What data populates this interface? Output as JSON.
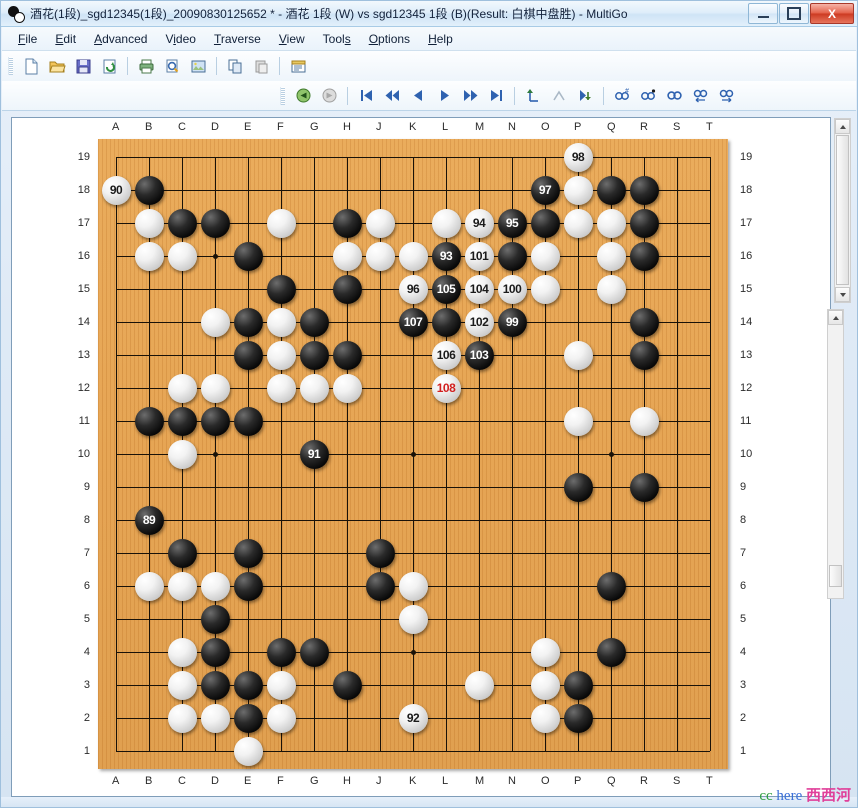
{
  "window": {
    "title": "酒花(1段)_sgd12345(1段)_20090830125652 * - 酒花 1段 (W) vs sgd12345 1段 (B)(Result: 白棋中盘胜) - MultiGo",
    "app_name": "MultiGo",
    "icon": "go-stones-icon",
    "minimize_label": "Minimize",
    "maximize_label": "Maximize",
    "close_label": "X"
  },
  "menu": {
    "items": [
      {
        "label": "File",
        "accel": "F"
      },
      {
        "label": "Edit",
        "accel": "E"
      },
      {
        "label": "Advanced",
        "accel": "A"
      },
      {
        "label": "Video",
        "accel": "i"
      },
      {
        "label": "Traverse",
        "accel": "T"
      },
      {
        "label": "View",
        "accel": "V"
      },
      {
        "label": "Tools",
        "accel": "s"
      },
      {
        "label": "Options",
        "accel": "O"
      },
      {
        "label": "Help",
        "accel": "H"
      }
    ]
  },
  "toolbar_file": {
    "buttons": [
      {
        "name": "new-icon",
        "label": "New"
      },
      {
        "name": "open-folder-icon",
        "label": "Open"
      },
      {
        "name": "save-disk-icon",
        "label": "Save"
      },
      {
        "name": "refresh-icon",
        "label": "Reload"
      },
      {
        "name": "print-icon",
        "label": "Print"
      },
      {
        "name": "print-preview-icon",
        "label": "Print Preview"
      },
      {
        "name": "export-image-icon",
        "label": "Export Image"
      },
      {
        "name": "copy-icon",
        "label": "Copy"
      },
      {
        "name": "paste-icon",
        "label": "Paste"
      },
      {
        "name": "properties-icon",
        "label": "Game Info"
      }
    ]
  },
  "toolbar_nav": {
    "buttons": [
      {
        "name": "black-to-move-icon",
        "label": "Black Move"
      },
      {
        "name": "white-to-move-icon",
        "label": "White Move"
      },
      {
        "name": "first-move-icon",
        "label": "First"
      },
      {
        "name": "rewind-icon",
        "label": "Back 10"
      },
      {
        "name": "prev-move-icon",
        "label": "Previous"
      },
      {
        "name": "next-move-icon",
        "label": "Next"
      },
      {
        "name": "forward-icon",
        "label": "Forward 10"
      },
      {
        "name": "last-move-icon",
        "label": "Last"
      },
      {
        "name": "branch-up-icon",
        "label": "Previous Branch"
      },
      {
        "name": "branch-merge-icon",
        "label": "Branch"
      },
      {
        "name": "branch-enter-icon",
        "label": "Enter Branch"
      },
      {
        "name": "find-number-icon",
        "label": "Find Move Number"
      },
      {
        "name": "find-mark-icon",
        "label": "Find Mark"
      },
      {
        "name": "find-icon",
        "label": "Find"
      },
      {
        "name": "find-prev-icon",
        "label": "Find Previous"
      },
      {
        "name": "find-next-icon",
        "label": "Find Next"
      }
    ]
  },
  "board": {
    "size": 19,
    "col_labels": [
      "A",
      "B",
      "C",
      "D",
      "E",
      "F",
      "G",
      "H",
      "J",
      "K",
      "L",
      "M",
      "N",
      "O",
      "P",
      "Q",
      "R",
      "S",
      "T"
    ],
    "row_labels": [
      "19",
      "18",
      "17",
      "16",
      "15",
      "14",
      "13",
      "12",
      "11",
      "10",
      "9",
      "8",
      "7",
      "6",
      "5",
      "4",
      "3",
      "2",
      "1"
    ],
    "wood_color": "#e3a04e",
    "line_color": "#1a1208",
    "hoshi": [
      [
        3,
        3
      ],
      [
        9,
        3
      ],
      [
        15,
        3
      ],
      [
        3,
        9
      ],
      [
        9,
        9
      ],
      [
        15,
        9
      ],
      [
        3,
        15
      ],
      [
        9,
        15
      ],
      [
        15,
        15
      ]
    ],
    "current_move_number": 108,
    "current_move_color": "#d22020",
    "stones": [
      {
        "c": "A",
        "r": 18,
        "col": "W",
        "n": "90"
      },
      {
        "c": "B",
        "r": 18,
        "col": "B"
      },
      {
        "c": "B",
        "r": 17,
        "col": "W"
      },
      {
        "c": "C",
        "r": 17,
        "col": "B"
      },
      {
        "c": "D",
        "r": 17,
        "col": "B"
      },
      {
        "c": "B",
        "r": 16,
        "col": "W"
      },
      {
        "c": "C",
        "r": 16,
        "col": "W"
      },
      {
        "c": "E",
        "r": 16,
        "col": "B"
      },
      {
        "c": "F",
        "r": 17,
        "col": "W"
      },
      {
        "c": "H",
        "r": 17,
        "col": "B"
      },
      {
        "c": "J",
        "r": 17,
        "col": "W"
      },
      {
        "c": "H",
        "r": 16,
        "col": "W"
      },
      {
        "c": "J",
        "r": 16,
        "col": "W"
      },
      {
        "c": "F",
        "r": 15,
        "col": "B"
      },
      {
        "c": "H",
        "r": 15,
        "col": "B"
      },
      {
        "c": "D",
        "r": 14,
        "col": "W"
      },
      {
        "c": "E",
        "r": 14,
        "col": "B"
      },
      {
        "c": "F",
        "r": 14,
        "col": "W"
      },
      {
        "c": "G",
        "r": 14,
        "col": "B"
      },
      {
        "c": "E",
        "r": 13,
        "col": "B"
      },
      {
        "c": "F",
        "r": 13,
        "col": "W"
      },
      {
        "c": "G",
        "r": 13,
        "col": "B"
      },
      {
        "c": "H",
        "r": 13,
        "col": "B"
      },
      {
        "c": "C",
        "r": 12,
        "col": "W"
      },
      {
        "c": "D",
        "r": 12,
        "col": "W"
      },
      {
        "c": "F",
        "r": 12,
        "col": "W"
      },
      {
        "c": "G",
        "r": 12,
        "col": "W"
      },
      {
        "c": "H",
        "r": 12,
        "col": "W"
      },
      {
        "c": "B",
        "r": 11,
        "col": "B"
      },
      {
        "c": "C",
        "r": 11,
        "col": "B"
      },
      {
        "c": "D",
        "r": 11,
        "col": "B"
      },
      {
        "c": "E",
        "r": 11,
        "col": "B"
      },
      {
        "c": "C",
        "r": 10,
        "col": "W"
      },
      {
        "c": "G",
        "r": 10,
        "col": "B",
        "n": "91"
      },
      {
        "c": "B",
        "r": 8,
        "col": "B",
        "n": "89"
      },
      {
        "c": "C",
        "r": 7,
        "col": "B"
      },
      {
        "c": "E",
        "r": 7,
        "col": "B"
      },
      {
        "c": "B",
        "r": 6,
        "col": "W"
      },
      {
        "c": "C",
        "r": 6,
        "col": "W"
      },
      {
        "c": "D",
        "r": 6,
        "col": "W"
      },
      {
        "c": "E",
        "r": 6,
        "col": "B"
      },
      {
        "c": "D",
        "r": 5,
        "col": "B"
      },
      {
        "c": "C",
        "r": 4,
        "col": "W"
      },
      {
        "c": "D",
        "r": 4,
        "col": "B"
      },
      {
        "c": "F",
        "r": 4,
        "col": "B"
      },
      {
        "c": "G",
        "r": 4,
        "col": "B"
      },
      {
        "c": "C",
        "r": 3,
        "col": "W"
      },
      {
        "c": "D",
        "r": 3,
        "col": "B"
      },
      {
        "c": "E",
        "r": 3,
        "col": "B"
      },
      {
        "c": "F",
        "r": 3,
        "col": "W"
      },
      {
        "c": "H",
        "r": 3,
        "col": "B"
      },
      {
        "c": "C",
        "r": 2,
        "col": "W"
      },
      {
        "c": "D",
        "r": 2,
        "col": "W"
      },
      {
        "c": "E",
        "r": 2,
        "col": "B"
      },
      {
        "c": "F",
        "r": 2,
        "col": "W"
      },
      {
        "c": "E",
        "r": 1,
        "col": "W"
      },
      {
        "c": "K",
        "r": 2,
        "col": "W",
        "n": "92"
      },
      {
        "c": "J",
        "r": 7,
        "col": "B"
      },
      {
        "c": "J",
        "r": 6,
        "col": "B"
      },
      {
        "c": "K",
        "r": 6,
        "col": "W"
      },
      {
        "c": "K",
        "r": 5,
        "col": "W"
      },
      {
        "c": "P",
        "r": 19,
        "col": "W",
        "n": "98"
      },
      {
        "c": "O",
        "r": 18,
        "col": "B",
        "n": "97"
      },
      {
        "c": "P",
        "r": 18,
        "col": "W"
      },
      {
        "c": "Q",
        "r": 18,
        "col": "B"
      },
      {
        "c": "R",
        "r": 18,
        "col": "B"
      },
      {
        "c": "L",
        "r": 17,
        "col": "W"
      },
      {
        "c": "M",
        "r": 17,
        "col": "W",
        "n": "94"
      },
      {
        "c": "N",
        "r": 17,
        "col": "B",
        "n": "95"
      },
      {
        "c": "O",
        "r": 17,
        "col": "B"
      },
      {
        "c": "P",
        "r": 17,
        "col": "W"
      },
      {
        "c": "Q",
        "r": 17,
        "col": "W"
      },
      {
        "c": "R",
        "r": 17,
        "col": "B"
      },
      {
        "c": "K",
        "r": 16,
        "col": "W"
      },
      {
        "c": "L",
        "r": 16,
        "col": "B",
        "n": "93"
      },
      {
        "c": "M",
        "r": 16,
        "col": "W",
        "n": "101"
      },
      {
        "c": "N",
        "r": 16,
        "col": "B"
      },
      {
        "c": "O",
        "r": 16,
        "col": "W"
      },
      {
        "c": "Q",
        "r": 16,
        "col": "W"
      },
      {
        "c": "R",
        "r": 16,
        "col": "B"
      },
      {
        "c": "K",
        "r": 15,
        "col": "W",
        "n": "96"
      },
      {
        "c": "L",
        "r": 15,
        "col": "B",
        "n": "105"
      },
      {
        "c": "M",
        "r": 15,
        "col": "W",
        "n": "104"
      },
      {
        "c": "N",
        "r": 15,
        "col": "W",
        "n": "100"
      },
      {
        "c": "O",
        "r": 15,
        "col": "W"
      },
      {
        "c": "Q",
        "r": 15,
        "col": "W"
      },
      {
        "c": "K",
        "r": 14,
        "col": "B",
        "n": "107"
      },
      {
        "c": "L",
        "r": 14,
        "col": "B"
      },
      {
        "c": "M",
        "r": 14,
        "col": "W",
        "n": "102"
      },
      {
        "c": "N",
        "r": 14,
        "col": "B",
        "n": "99"
      },
      {
        "c": "R",
        "r": 14,
        "col": "B"
      },
      {
        "c": "L",
        "r": 13,
        "col": "W",
        "n": "106"
      },
      {
        "c": "M",
        "r": 13,
        "col": "B",
        "n": "103"
      },
      {
        "c": "P",
        "r": 13,
        "col": "W"
      },
      {
        "c": "R",
        "r": 13,
        "col": "B"
      },
      {
        "c": "L",
        "r": 12,
        "col": "W",
        "n": "108",
        "cur": true
      },
      {
        "c": "P",
        "r": 11,
        "col": "W"
      },
      {
        "c": "R",
        "r": 11,
        "col": "W"
      },
      {
        "c": "P",
        "r": 9,
        "col": "B"
      },
      {
        "c": "R",
        "r": 9,
        "col": "B"
      },
      {
        "c": "Q",
        "r": 6,
        "col": "B"
      },
      {
        "c": "O",
        "r": 4,
        "col": "W"
      },
      {
        "c": "Q",
        "r": 4,
        "col": "B"
      },
      {
        "c": "O",
        "r": 3,
        "col": "W"
      },
      {
        "c": "P",
        "r": 3,
        "col": "B"
      },
      {
        "c": "M",
        "r": 3,
        "col": "W"
      },
      {
        "c": "O",
        "r": 2,
        "col": "W"
      },
      {
        "c": "P",
        "r": 2,
        "col": "B"
      }
    ]
  },
  "scrollbars": {
    "vertical_outer": {
      "name": "vertical-scrollbar-outer"
    },
    "vertical_inner": {
      "name": "vertical-scrollbar-inner"
    },
    "up_arrow": "▲",
    "down_arrow": "▼"
  },
  "watermark": {
    "part1": "cc",
    "part2": "here",
    "part3": "西西河"
  }
}
